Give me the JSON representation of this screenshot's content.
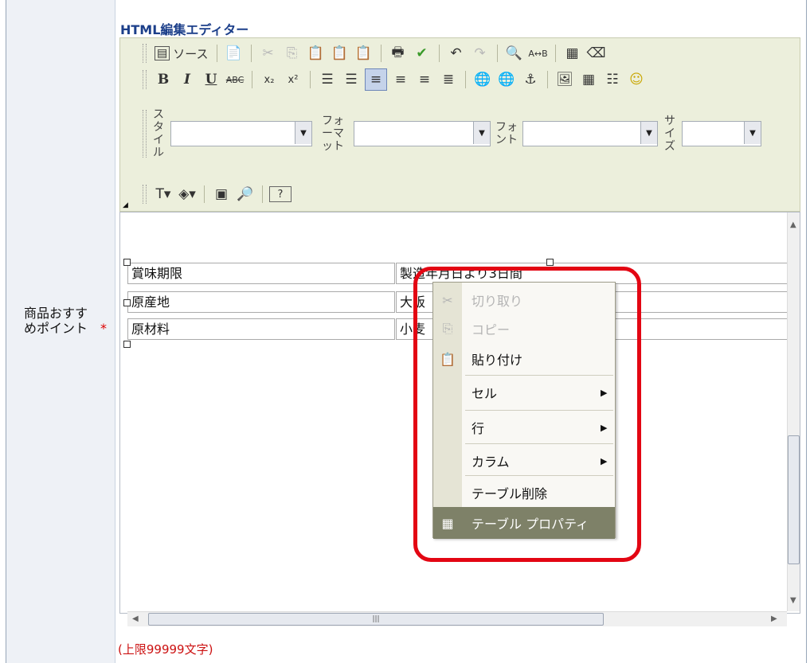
{
  "editor": {
    "title": "HTML編集エディター",
    "toolbar_row1": {
      "source_label": "ソース"
    },
    "toolbar_row3": {
      "style_label": "スタイル",
      "format_label": "フォーマット",
      "font_label": "フォント",
      "size_label": "サイズ"
    }
  },
  "field": {
    "label": "商品おすすめポイント",
    "required_mark": "*",
    "limit_note": "(上限99999文字)"
  },
  "table": {
    "rows": [
      [
        "賞味期限",
        "製造年月日より3日間"
      ],
      [
        "原産地",
        "大阪"
      ],
      [
        "原材料",
        "小麦"
      ]
    ]
  },
  "context_menu": {
    "items": [
      {
        "label": "切り取り",
        "icon": "cut-icon",
        "state": "disabled"
      },
      {
        "label": "コピー",
        "icon": "copy-icon",
        "state": "disabled"
      },
      {
        "label": "貼り付け",
        "icon": "paste-icon",
        "state": "enabled"
      },
      {
        "label": "セル",
        "submenu": true
      },
      {
        "label": "行",
        "submenu": true
      },
      {
        "label": "カラム",
        "submenu": true
      },
      {
        "label": "テーブル削除"
      },
      {
        "label": "テーブル プロパティ",
        "icon": "table-icon",
        "state": "highlighted"
      }
    ]
  },
  "colors": {
    "highlight_box": "#e30613",
    "menu_highlight": "#7e8168",
    "toolbar_bg": "#ecefdc",
    "title_blue": "#1c3f8a"
  }
}
